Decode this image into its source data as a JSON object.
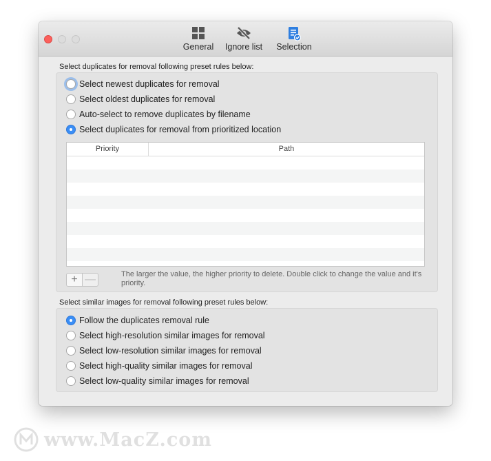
{
  "toolbar": {
    "general": {
      "label": "General",
      "icon": "grid-icon"
    },
    "ignore": {
      "label": "Ignore list",
      "icon": "eye-slash-icon"
    },
    "selection": {
      "label": "Selection",
      "icon": "document-check-icon"
    }
  },
  "duplicates": {
    "section_label": "Select duplicates for removal following preset rules below:",
    "options": [
      {
        "label": "Select newest duplicates for removal",
        "checked": false,
        "focused": true
      },
      {
        "label": "Select oldest duplicates for removal",
        "checked": false
      },
      {
        "label": "Auto-select to remove duplicates by filename",
        "checked": false
      },
      {
        "label": "Select duplicates for removal from prioritized location",
        "checked": true
      }
    ],
    "table": {
      "columns": [
        "Priority",
        "Path"
      ],
      "rows": []
    },
    "add_label": "+",
    "remove_label": "—",
    "hint": "The larger the value, the higher priority to delete.  Double click to change the value and it's priority."
  },
  "similar": {
    "section_label": "Select similar images for removal following preset rules below:",
    "options": [
      {
        "label": "Follow the duplicates removal rule",
        "checked": true
      },
      {
        "label": "Select high-resolution similar images for removal",
        "checked": false
      },
      {
        "label": "Select low-resolution similar images for removal",
        "checked": false
      },
      {
        "label": "Select high-quality similar images for removal",
        "checked": false
      },
      {
        "label": "Select low-quality similar images for removal",
        "checked": false
      }
    ]
  },
  "watermark": {
    "text": "www.MacZ.com"
  },
  "colors": {
    "accent": "#3a8ef6",
    "close": "#fc605c",
    "icon_blue": "#2f7fe0"
  }
}
